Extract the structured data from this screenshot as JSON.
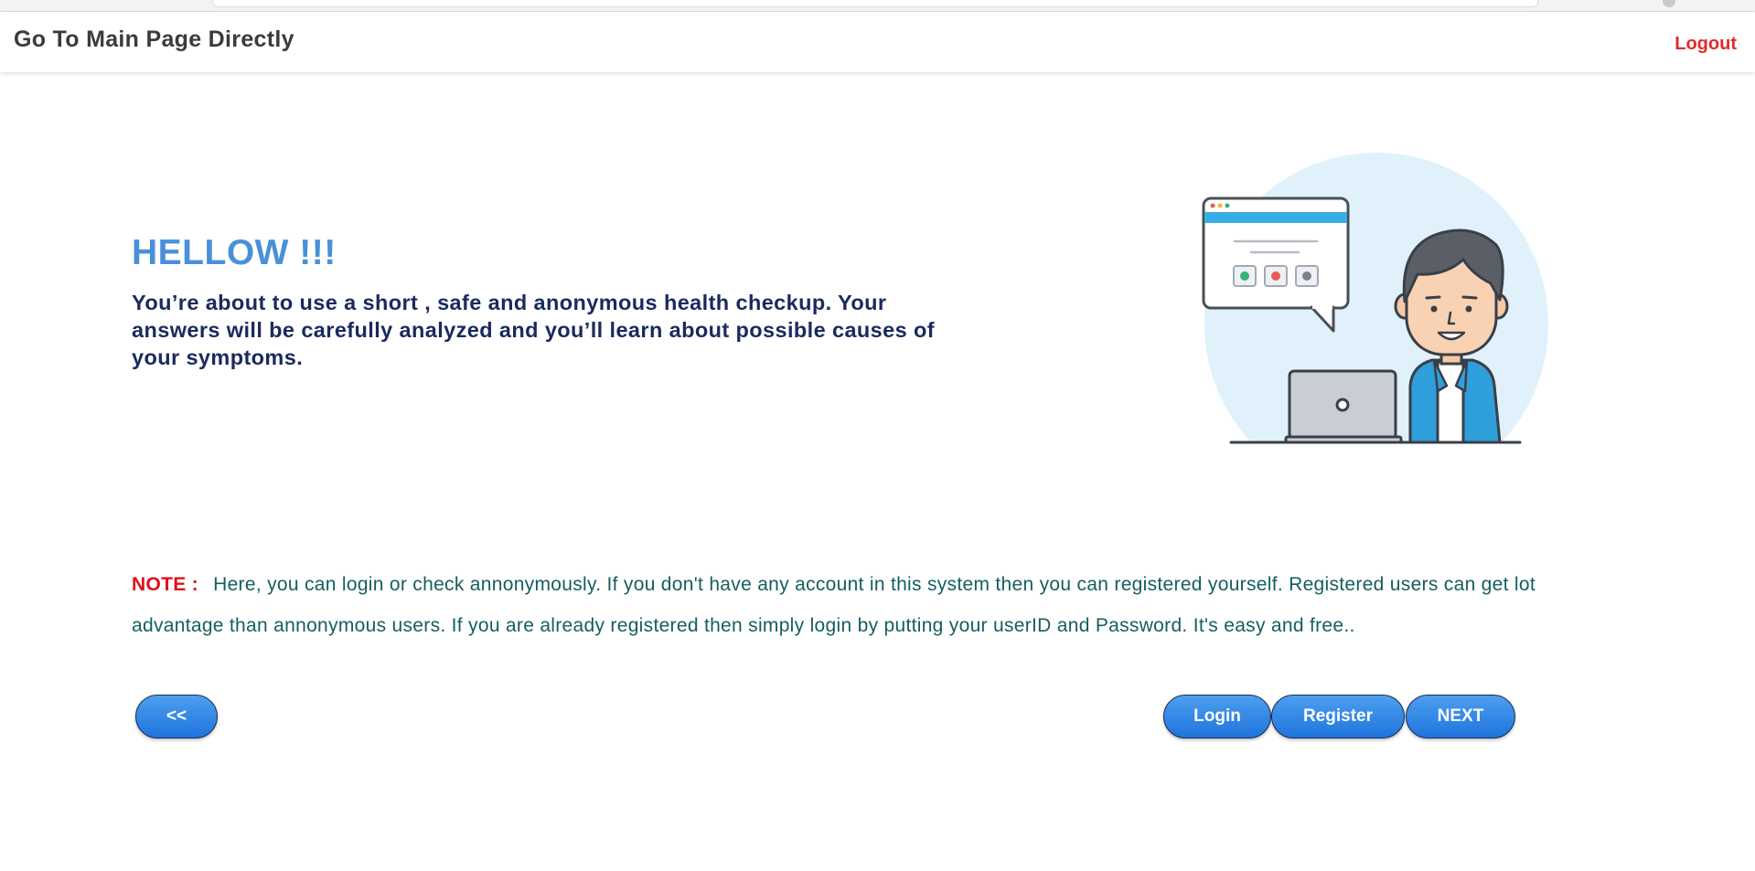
{
  "nav": {
    "brand": "Go To Main Page Directly",
    "logout": "Logout"
  },
  "hero": {
    "heading": "HELLOW !!!",
    "intro": "You’re about to use a short , safe and anonymous health checkup. Your answers will be carefully analyzed and you’ll learn about possible causes of your symptoms."
  },
  "note": {
    "label": "NOTE :",
    "text": "Here, you can login or check annonymously. If you don't have any account in this system then you can registered yourself. Registered users can get lot advantage than annonymous users. If you are already registered then simply login by putting your userID and Password. It's easy and free.."
  },
  "buttons": {
    "back": "<<",
    "login": "Login",
    "register": "Register",
    "next": "NEXT"
  },
  "colors": {
    "brand_text": "#3b3b3b",
    "logout": "#e02b2b",
    "heading": "#4a90d9",
    "intro": "#1a2a5e",
    "note_label": "#e0101a",
    "note_text": "#165e5e",
    "button": "#1e74dc"
  },
  "illustration": {
    "icon": "person-with-laptop-and-chat-bubble-illustration"
  }
}
